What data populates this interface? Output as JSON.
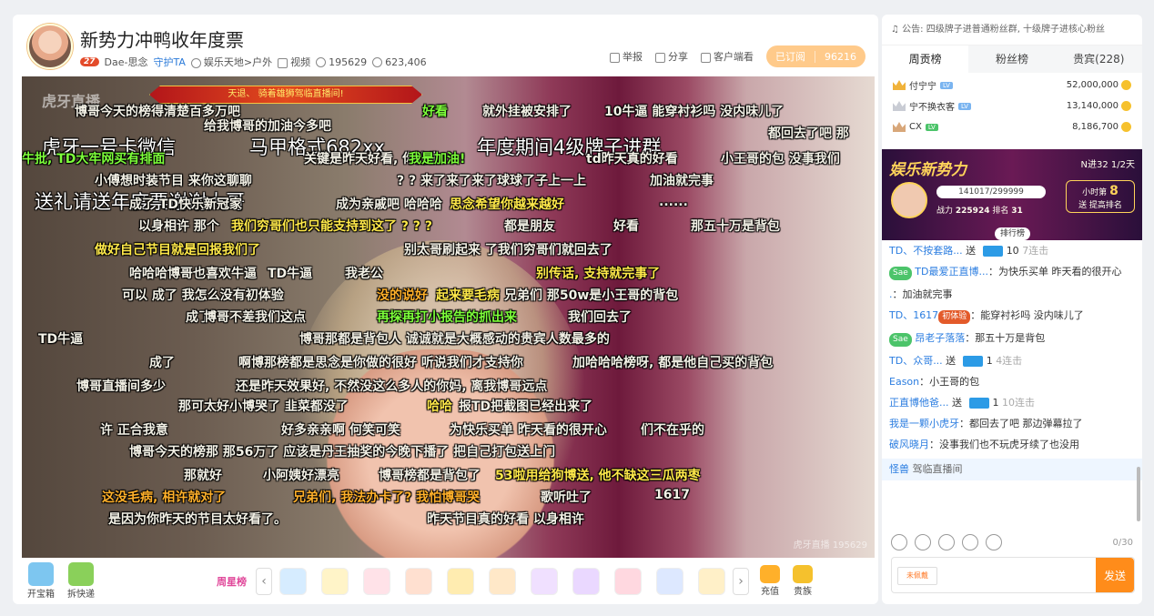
{
  "room": {
    "title": "新势力冲鸭收年度票",
    "level": "27",
    "anchor": "Dae-思念",
    "guard": "守护TA",
    "category_prefix": "娱乐天地",
    "category": "户外",
    "video_label": "视频",
    "room_id": "195629",
    "fans": "623,406",
    "report": "举报",
    "share": "分享",
    "client": "客户端看",
    "subscribed": "已订阅",
    "sub_count": "96216"
  },
  "video": {
    "watermark": "虎牙直播",
    "banner": "天退、 骑着雄狮驾临直播间!",
    "corner_watermark": "虎牙直播 195629",
    "danmaku": [
      {
        "t": "博哥今天的榜得清楚百多万吧",
        "c": ""
      },
      {
        "t": "好看",
        "c": "g"
      },
      {
        "t": "就外挂被安排了",
        "c": ""
      },
      {
        "t": "10牛逼 能穿衬衫吗 没内味儿了",
        "c": ""
      },
      {
        "t": "给我博哥的加油今多吧",
        "c": ""
      },
      {
        "t": "都回去了吧 那",
        "c": ""
      },
      {
        "t": "虎牙一号卡微信",
        "c": "big"
      },
      {
        "t": "马甲格式682xx",
        "c": "big"
      },
      {
        "t": "年度期间4级牌子进群",
        "c": "big"
      },
      {
        "t": "牛批, TD大牢网买有排面",
        "c": "g"
      },
      {
        "t": "关键是昨天好看, 你比生",
        "c": ""
      },
      {
        "t": "我是加油!",
        "c": "g"
      },
      {
        "t": "td昨天真的好看",
        "c": ""
      },
      {
        "t": "小王哥的包 没事我们",
        "c": ""
      },
      {
        "t": "小傅想时装节目 来你这聊聊",
        "c": ""
      },
      {
        "t": "? ? 来了来了来了球球了子上一上",
        "c": ""
      },
      {
        "t": "加油就完事",
        "c": ""
      },
      {
        "t": "送礼请送年度票谢谢大哥",
        "c": "big"
      },
      {
        "t": "成了 TD快乐新冠家",
        "c": ""
      },
      {
        "t": "成为亲戚吧 哈哈哈",
        "c": ""
      },
      {
        "t": "思念希望你越来越好",
        "c": "y"
      },
      {
        "t": "......",
        "c": ""
      },
      {
        "t": "以身相许 那个",
        "c": ""
      },
      {
        "t": "我们穷哥们也只能支持到这了 ? ? ?",
        "c": "y"
      },
      {
        "t": "都是朋友",
        "c": ""
      },
      {
        "t": "好看",
        "c": ""
      },
      {
        "t": "那五十万是背包",
        "c": ""
      },
      {
        "t": "做好自己节目就是回报我们了",
        "c": "y"
      },
      {
        "t": "别太哥刷起来 了我们穷哥们就回去了",
        "c": ""
      },
      {
        "t": "哈哈哈博哥也喜欢牛逼",
        "c": ""
      },
      {
        "t": "TD牛逼",
        "c": ""
      },
      {
        "t": "我老公",
        "c": ""
      },
      {
        "t": "别传话, 支持就完事了",
        "c": "y"
      },
      {
        "t": "可以 成了  我怎么没有初体验",
        "c": ""
      },
      {
        "t": "没的说好",
        "c": "o"
      },
      {
        "t": "起来要毛病",
        "c": "y"
      },
      {
        "t": "兄弟们  那50w是小王哥的背包",
        "c": ""
      },
      {
        "t": "成了",
        "c": ""
      },
      {
        "t": "博哥不差我们这点",
        "c": ""
      },
      {
        "t": "再探再打小报告的抓出来",
        "c": "g"
      },
      {
        "t": "我们回去了",
        "c": ""
      },
      {
        "t": "TD牛逼",
        "c": ""
      },
      {
        "t": "博哥那都是背包人 诚诚就是大概感动的贵宾人数最多的",
        "c": ""
      },
      {
        "t": "成了",
        "c": ""
      },
      {
        "t": "啊博那榜都是思念是你做的很好 听说我们才支持你",
        "c": ""
      },
      {
        "t": "加哈哈哈榜呀, 都是他自己买的背包",
        "c": ""
      },
      {
        "t": "博哥直播间多少",
        "c": ""
      },
      {
        "t": "还是昨天效果好, 不然没这么多人的你妈, 离我博哥远点",
        "c": ""
      },
      {
        "t": "那可太好小博哭了 韭菜都没了",
        "c": ""
      },
      {
        "t": "哈哈",
        "c": "y"
      },
      {
        "t": "报TD把截图已经出来了",
        "c": ""
      },
      {
        "t": "许 正合我意",
        "c": ""
      },
      {
        "t": "好多亲亲啊 何笑可笑",
        "c": ""
      },
      {
        "t": "为快乐买单 昨天看的很开心",
        "c": ""
      },
      {
        "t": "们不在乎的",
        "c": ""
      },
      {
        "t": "博哥今天的榜那 那56万了 应该是丹王抽奖的今晚下播了 把自己打包送上门",
        "c": ""
      },
      {
        "t": "那就好",
        "c": ""
      },
      {
        "t": "小阿姨好漂亮",
        "c": ""
      },
      {
        "t": "博哥榜都是背包了",
        "c": ""
      },
      {
        "t": "53啦用给狗博送, 他不缺这三瓜两枣",
        "c": "y"
      },
      {
        "t": "这没毛病, 相许就对了",
        "c": "o"
      },
      {
        "t": "兄弟们, 我法办卡了? 我怕博哥哭",
        "c": "o"
      },
      {
        "t": "歌听吐了",
        "c": ""
      },
      {
        "t": "1617",
        "c": ""
      },
      {
        "t": "是因为你昨天的节目太好看了。",
        "c": ""
      },
      {
        "t": "昨天节目真的好看 以身相许",
        "c": ""
      }
    ]
  },
  "gifts": {
    "tool1": "开宝箱",
    "tool2": "拆快递",
    "weekstar": "周星榜",
    "recharge": "充值",
    "noble": "贵族"
  },
  "sidebar": {
    "notice": "公告: 四级牌子进普通粉丝群, 十级牌子进核心粉丝",
    "tabs": [
      "周贡榜",
      "粉丝榜",
      "贵宾(228)"
    ],
    "rank": [
      {
        "name": "付宁宁",
        "value": "52,000,000"
      },
      {
        "name": "宁不换衣客",
        "value": "13,140,000"
      },
      {
        "name": "CX",
        "value": "8,186,700"
      }
    ],
    "promo": {
      "title": "娱乐新势力",
      "rank": "N进32 1/2天",
      "progress": "141017/299999",
      "power": "战力",
      "power_val": "225924",
      "pos": "排名",
      "pos_val": "31",
      "hour": "小时第",
      "hour_val": "8",
      "boost": "送 提高排名",
      "board": "排行榜"
    },
    "chat": [
      {
        "u": "TD、不按套路...",
        "a": "送",
        "n": "10",
        "x": "7连击"
      },
      {
        "b": "Sae",
        "u": "TD最爱正直博...",
        "m": "：为快乐买单 昨天看的很开心"
      },
      {
        "u": ".",
        "m": "：加油就完事"
      },
      {
        "u": "TD、1617",
        "tag": "初体验",
        "m": "：能穿衬衫吗 没内味儿了"
      },
      {
        "b": "Sae",
        "u": "昂老子落落",
        "m": "：那五十万是背包"
      },
      {
        "u": "TD、众哥...",
        "a": "送",
        "n": "1",
        "x": "4连击"
      },
      {
        "u": "Eason",
        "m": "：小王哥的包"
      },
      {
        "u": "正直博他爸...",
        "a": "送",
        "n": "1",
        "x": "10连击"
      },
      {
        "u": "我是一颗小虎牙",
        "m": "：都回去了吧 那边弹幕拉了"
      },
      {
        "u": "破风晓月",
        "m": "：没事我们也不玩虎牙续了也没用"
      }
    ],
    "enter_user": "怪兽",
    "enter_text": "驾临直播间",
    "counter": "0/30",
    "fan_badge": "未佩戴",
    "send": "发送"
  }
}
